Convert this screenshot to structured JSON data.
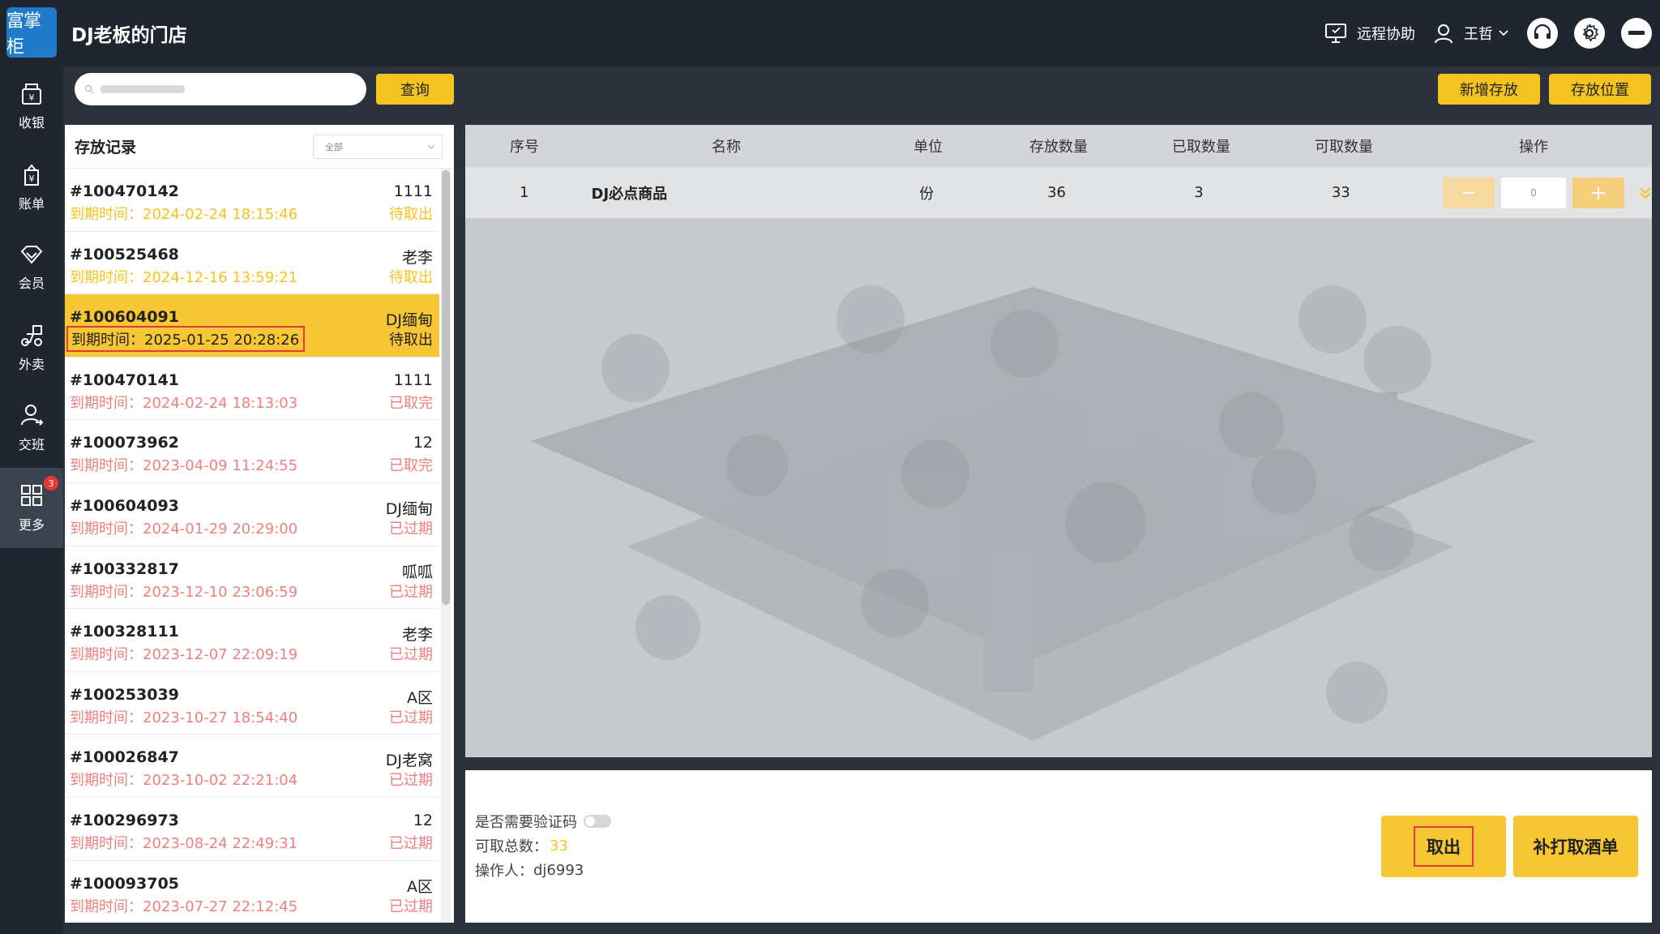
{
  "header": {
    "logo_text": "富掌柜",
    "store_name": "DJ老板的门店",
    "remote_help": "远程协助",
    "user_name": "王哲"
  },
  "sidebar": {
    "items": [
      {
        "label": "收银",
        "icon": "cashier-icon"
      },
      {
        "label": "账单",
        "icon": "bill-icon"
      },
      {
        "label": "会员",
        "icon": "member-icon"
      },
      {
        "label": "外卖",
        "icon": "delivery-icon"
      },
      {
        "label": "交班",
        "icon": "shift-icon"
      },
      {
        "label": "更多",
        "icon": "grid-icon",
        "badge": "3"
      }
    ]
  },
  "search": {
    "placeholder": "",
    "button": "查询"
  },
  "actions": {
    "new_storage": "新增存放",
    "storage_location": "存放位置"
  },
  "records": {
    "title": "存放记录",
    "filter": "全部",
    "items": [
      {
        "id": "#100470142",
        "time": "到期时间：2024-02-24 18:15:46",
        "name": "1111",
        "status": "待取出",
        "type": "pending"
      },
      {
        "id": "#100525468",
        "time": "到期时间：2024-12-16 13:59:21",
        "name": "老李",
        "status": "待取出",
        "type": "pending"
      },
      {
        "id": "#100604091",
        "time": "到期时间：2025-01-25 20:28:26",
        "name": "DJ缅甸",
        "status": "待取出",
        "type": "selected"
      },
      {
        "id": "#100470141",
        "time": "到期时间：2024-02-24 18:13:03",
        "name": "1111",
        "status": "已取完",
        "type": "done"
      },
      {
        "id": "#100073962",
        "time": "到期时间：2023-04-09 11:24:55",
        "name": "12",
        "status": "已取完",
        "type": "done"
      },
      {
        "id": "#100604093",
        "time": "到期时间：2024-01-29 20:29:00",
        "name": "DJ缅甸",
        "status": "已过期",
        "type": "expired"
      },
      {
        "id": "#100332817",
        "time": "到期时间：2023-12-10 23:06:59",
        "name": "呱呱",
        "status": "已过期",
        "type": "expired"
      },
      {
        "id": "#100328111",
        "time": "到期时间：2023-12-07 22:09:19",
        "name": "老李",
        "status": "已过期",
        "type": "expired"
      },
      {
        "id": "#100253039",
        "time": "到期时间：2023-10-27 18:54:40",
        "name": "A区",
        "status": "已过期",
        "type": "expired"
      },
      {
        "id": "#100026847",
        "time": "到期时间：2023-10-02 22:21:04",
        "name": "DJ老窝",
        "status": "已过期",
        "type": "expired"
      },
      {
        "id": "#100296973",
        "time": "到期时间：2023-08-24 22:49:31",
        "name": "12",
        "status": "已过期",
        "type": "expired"
      },
      {
        "id": "#100093705",
        "time": "到期时间：2023-07-27 22:12:45",
        "name": "A区",
        "status": "已过期",
        "type": "expired"
      }
    ]
  },
  "table": {
    "headers": [
      "序号",
      "名称",
      "单位",
      "存放数量",
      "已取数量",
      "可取数量",
      "操作"
    ],
    "rows": [
      {
        "index": "1",
        "name": "DJ必点商品",
        "unit": "份",
        "stored": "36",
        "taken": "3",
        "available": "33",
        "qty": "0"
      }
    ]
  },
  "bottom": {
    "verify_label": "是否需要验证码",
    "total_label": "可取总数：",
    "total_value": "33",
    "operator_label": "操作人：",
    "operator_value": "dj6993",
    "take_out": "取出",
    "reprint": "补打取酒单"
  },
  "colors": {
    "accent": "#f5c31f",
    "expired": "#ef7f7f",
    "dark": "#1f262f"
  }
}
